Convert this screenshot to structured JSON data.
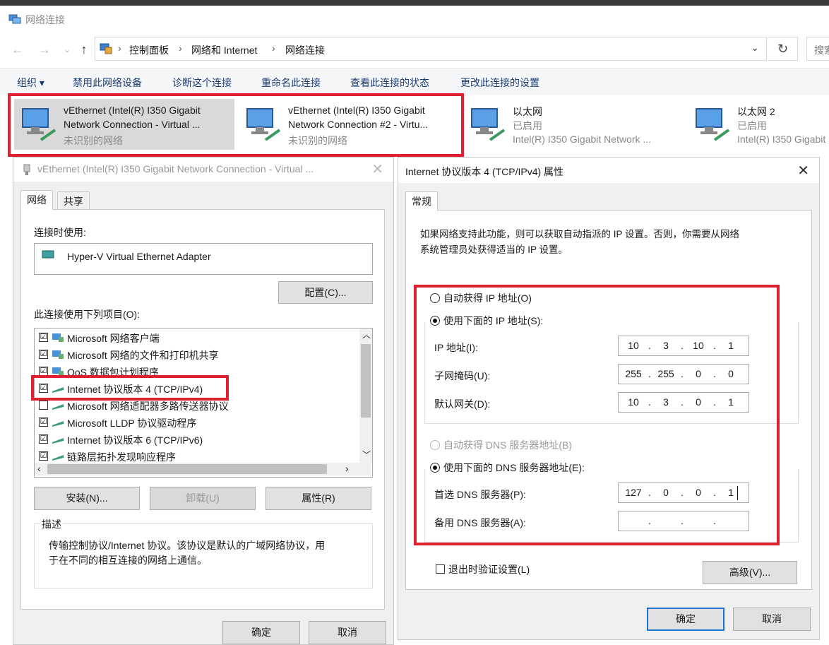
{
  "window": {
    "title": "网络连接"
  },
  "breadcrumb": [
    "控制面板",
    "网络和 Internet",
    "网络连接"
  ],
  "search": {
    "placeholder": "搜索"
  },
  "toolbar": {
    "organize": "组织 ▾",
    "disable": "禁用此网络设备",
    "diagnose": "诊断这个连接",
    "rename": "重命名此连接",
    "status": "查看此连接的状态",
    "settings": "更改此连接的设置"
  },
  "connections": [
    {
      "line1": "vEthernet (Intel(R) I350 Gigabit",
      "line2": "Network Connection - Virtual ...",
      "line3": "未识别的网络"
    },
    {
      "line1": "vEthernet (Intel(R) I350 Gigabit",
      "line2": "Network Connection #2 - Virtu...",
      "line3": "未识别的网络"
    },
    {
      "line1": "以太网",
      "line2": "已启用",
      "line3": "Intel(R) I350 Gigabit Network ..."
    },
    {
      "line1": "以太网 2",
      "line2": "已启用",
      "line3": "Intel(R) I350 Gigabit"
    }
  ],
  "adapter_dialog": {
    "title": "vEthernet (Intel(R) I350 Gigabit Network Connection - Virtual ...",
    "tabs": [
      "网络",
      "共享"
    ],
    "connect_using_label": "连接时使用:",
    "adapter_name": "Hyper-V Virtual Ethernet Adapter",
    "configure_button": "配置(C)...",
    "items_label": "此连接使用下列项目(O):",
    "items": [
      {
        "label": "Microsoft 网络客户端",
        "checked": "☑"
      },
      {
        "label": "Microsoft 网络的文件和打印机共享",
        "checked": "☑"
      },
      {
        "label": "QoS 数据包计划程序",
        "checked": "☑"
      },
      {
        "label": "Internet 协议版本 4 (TCP/IPv4)",
        "checked": "☑"
      },
      {
        "label": "Microsoft 网络适配器多路传送器协议",
        "checked": ""
      },
      {
        "label": "Microsoft LLDP 协议驱动程序",
        "checked": "☑"
      },
      {
        "label": "Internet 协议版本 6 (TCP/IPv6)",
        "checked": "☑"
      },
      {
        "label": "链路层拓扑发现响应程序",
        "checked": "☑"
      }
    ],
    "install_button": "安装(N)...",
    "uninstall_button": "卸载(U)",
    "properties_button": "属性(R)",
    "description_label": "描述",
    "description_text_1": "传输控制协议/Internet 协议。该协议是默认的广域网络协议，用",
    "description_text_2": "于在不同的相互连接的网络上通信。",
    "ok_button": "确定",
    "cancel_button": "取消"
  },
  "ipv4_dialog": {
    "title": "Internet 协议版本 4 (TCP/IPv4) 属性",
    "tab": "常规",
    "intro_1": "如果网络支持此功能，则可以获取自动指派的 IP 设置。否则，你需要从网络",
    "intro_2": "系统管理员处获得适当的 IP 设置。",
    "auto_ip": "自动获得 IP 地址(O)",
    "manual_ip": "使用下面的 IP 地址(S):",
    "ip_label": "IP 地址(I):",
    "ip_value": [
      "10",
      "3",
      "10",
      "1"
    ],
    "mask_label": "子网掩码(U):",
    "mask_value": [
      "255",
      "255",
      "0",
      "0"
    ],
    "gateway_label": "默认网关(D):",
    "gateway_value": [
      "10",
      "3",
      "0",
      "1"
    ],
    "auto_dns": "自动获得 DNS 服务器地址(B)",
    "manual_dns": "使用下面的 DNS 服务器地址(E):",
    "preferred_dns_label": "首选 DNS 服务器(P):",
    "preferred_dns_value": [
      "127",
      "0",
      "0",
      "1"
    ],
    "alternate_dns_label": "备用 DNS 服务器(A):",
    "alternate_dns_value": [
      "",
      "",
      "",
      ""
    ],
    "validate_on_exit": "退出时验证设置(L)",
    "advanced_button": "高级(V)...",
    "ok_button": "确定",
    "cancel_button": "取消"
  },
  "colors": {
    "highlight_red": "#e02030",
    "link_blue": "#1a3b70",
    "selected_gray": "#d9d9d9"
  }
}
